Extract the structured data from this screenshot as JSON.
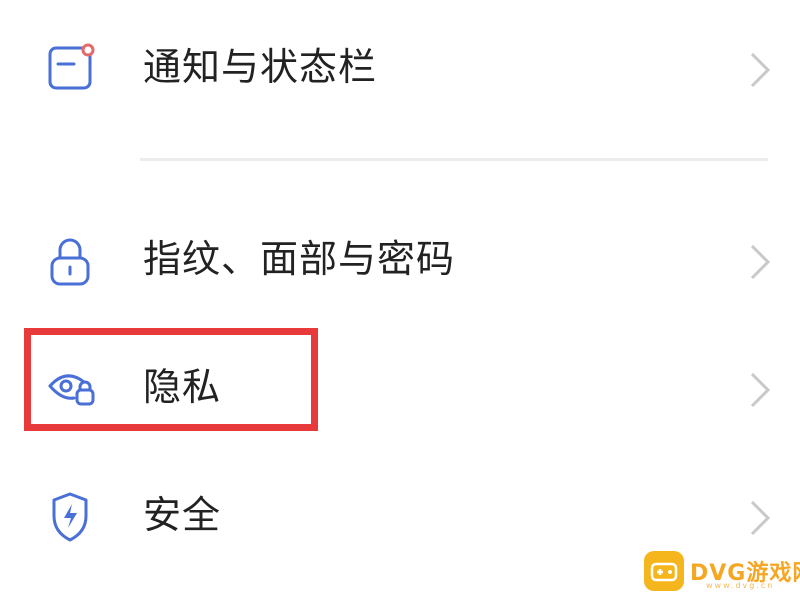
{
  "settings": {
    "items": [
      {
        "label": "通知与状态栏",
        "icon": "notification-icon"
      },
      {
        "label": "指纹、面部与密码",
        "icon": "lock-icon"
      },
      {
        "label": "隐私",
        "icon": "privacy-eye-lock-icon"
      },
      {
        "label": "安全",
        "icon": "shield-bolt-icon"
      }
    ]
  },
  "highlight": {
    "color": "#e83a3a"
  },
  "watermark": {
    "text": "DVG游戏网",
    "sub": "www.dvg.cn"
  },
  "colors": {
    "icon": "#4a6fd6",
    "chevron": "#c9c9c9",
    "text": "#222222"
  }
}
